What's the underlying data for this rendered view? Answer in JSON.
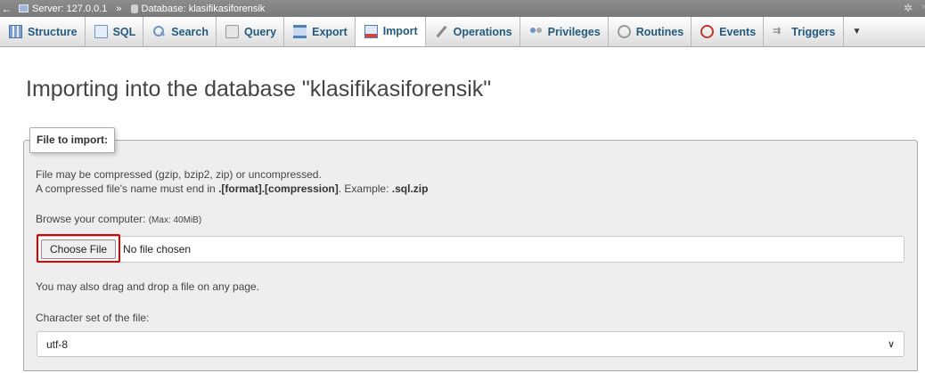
{
  "breadcrumb": {
    "back": "←",
    "server_label": "Server: 127.0.0.1",
    "separator": "»",
    "database_label": "Database: klasifikasiforensik"
  },
  "tabs": [
    {
      "label": "Structure",
      "icon": "structure-icon"
    },
    {
      "label": "SQL",
      "icon": "sql-icon"
    },
    {
      "label": "Search",
      "icon": "search-icon"
    },
    {
      "label": "Query",
      "icon": "query-icon"
    },
    {
      "label": "Export",
      "icon": "export-icon"
    },
    {
      "label": "Import",
      "icon": "import-icon",
      "active": true
    },
    {
      "label": "Operations",
      "icon": "operations-icon"
    },
    {
      "label": "Privileges",
      "icon": "privileges-icon"
    },
    {
      "label": "Routines",
      "icon": "routines-icon"
    },
    {
      "label": "Events",
      "icon": "events-icon"
    },
    {
      "label": "Triggers",
      "icon": "triggers-icon"
    }
  ],
  "tabs_more": "▼",
  "page_title": "Importing into the database \"klasifikasiforensik\"",
  "file_section": {
    "legend": "File to import:",
    "note_line1": "File may be compressed (gzip, bzip2, zip) or uncompressed.",
    "note_line2_prefix": "A compressed file's name must end in ",
    "note_line2_bold1": ".[format].[compression]",
    "note_line2_mid": ". Example: ",
    "note_line2_bold2": ".sql.zip",
    "browse_label": "Browse your computer: ",
    "browse_max": "(Max: 40MiB)",
    "choose_button": "Choose File",
    "no_file": "No file chosen",
    "drag_note": "You may also drag and drop a file on any page.",
    "charset_label": "Character set of the file:",
    "charset_value": "utf-8"
  },
  "colors": {
    "tab_text": "#235a81",
    "highlight": "#e00000",
    "fieldset_bg": "#eeeeee"
  }
}
